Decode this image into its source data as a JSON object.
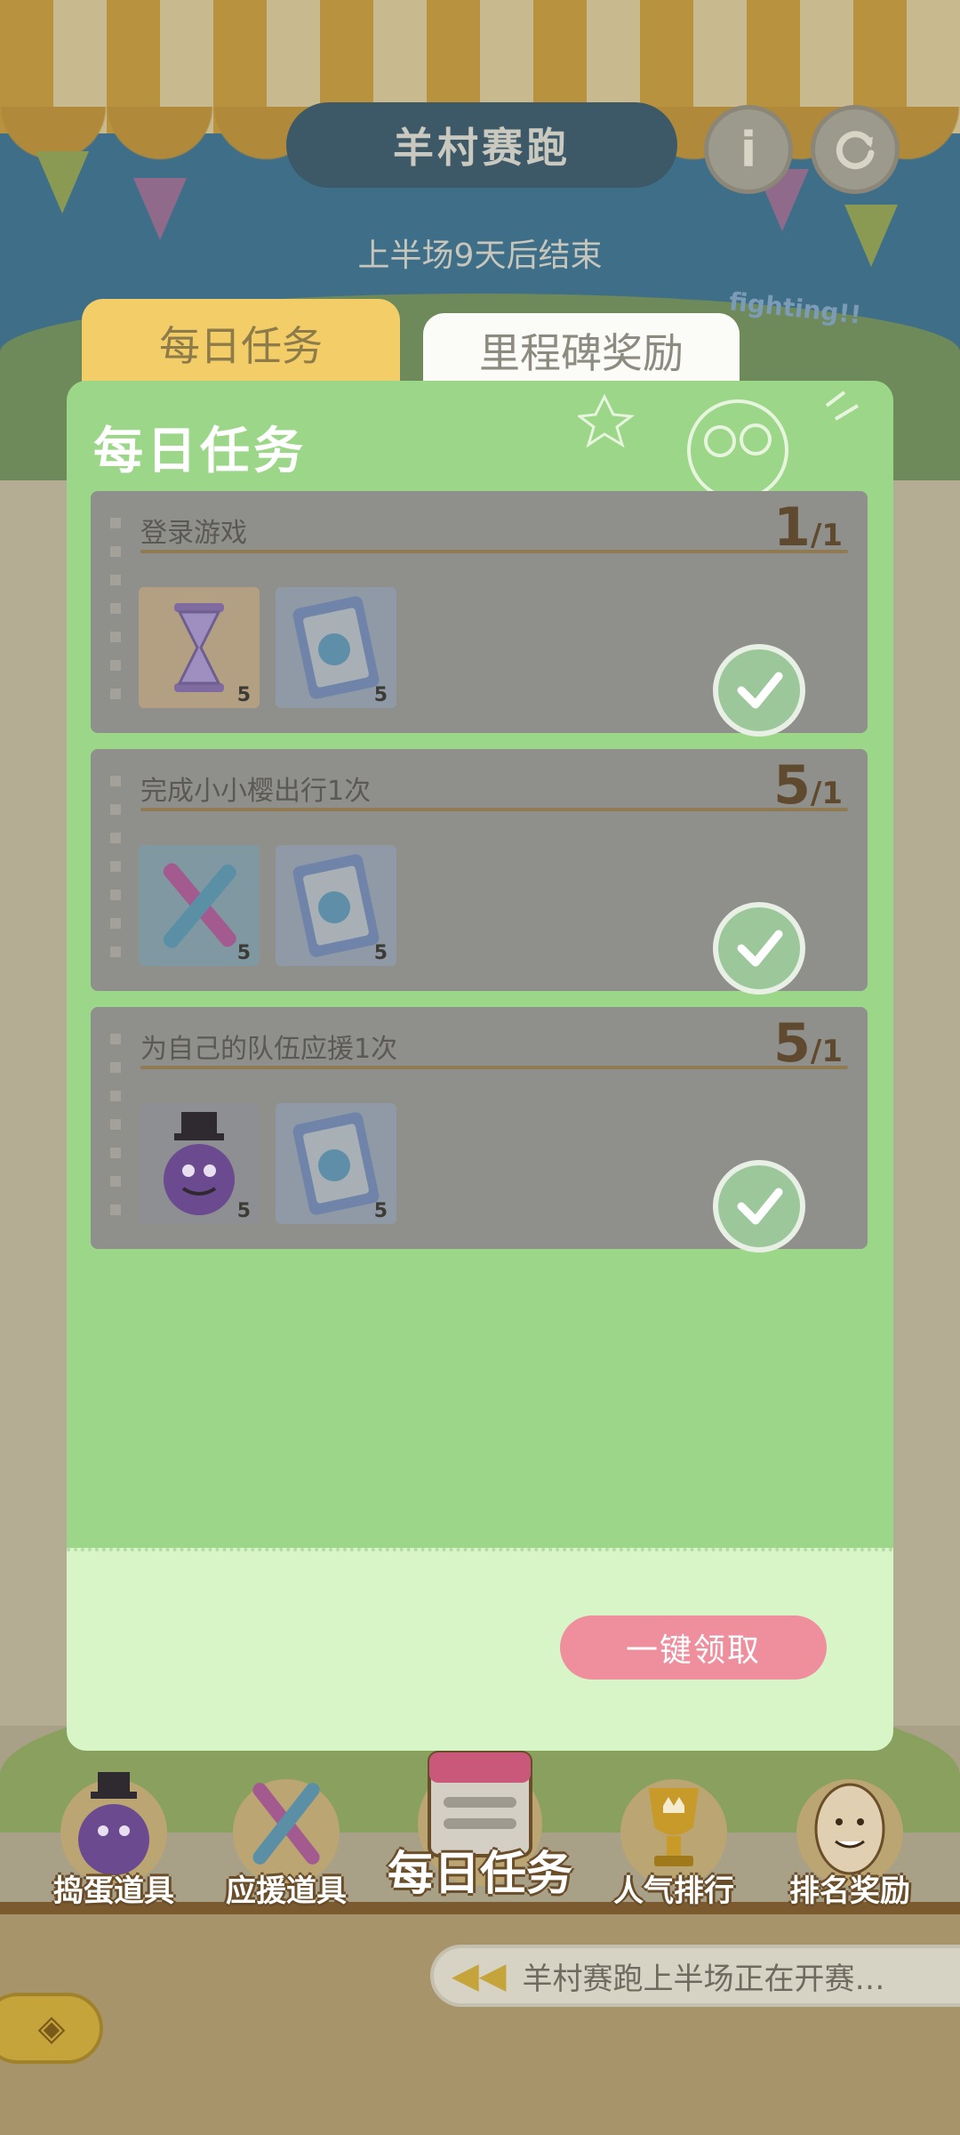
{
  "header": {
    "title": "羊村赛跑",
    "subtitle": "上半场9天后结束",
    "info_icon": "info-icon",
    "refresh_icon": "refresh-icon",
    "bubble_text": "fighting!!"
  },
  "tabs": [
    {
      "label": "每日任务",
      "active": true
    },
    {
      "label": "里程碑奖励",
      "active": false
    }
  ],
  "panel": {
    "title": "每日任务",
    "tasks": [
      {
        "name": "登录游戏",
        "progress": "1",
        "total": "/1",
        "rewards": [
          {
            "icon": "hourglass-icon",
            "count": "5"
          },
          {
            "icon": "ticket-card-icon",
            "count": "5"
          }
        ],
        "completed": true
      },
      {
        "name": "完成小小樱出行1次",
        "progress": "5",
        "total": "/1",
        "rewards": [
          {
            "icon": "glow-sticks-icon",
            "count": "5"
          },
          {
            "icon": "ticket-card-icon",
            "count": "5"
          }
        ],
        "completed": true
      },
      {
        "name": "为自己的队伍应援1次",
        "progress": "5",
        "total": "/1",
        "rewards": [
          {
            "icon": "purple-monster-icon",
            "count": "5"
          },
          {
            "icon": "ticket-card-icon",
            "count": "5"
          }
        ],
        "completed": true
      }
    ],
    "claim_all_label": "一键领取"
  },
  "bottom_nav": [
    {
      "label": "捣蛋道具",
      "icon": "purple-monster-icon"
    },
    {
      "label": "应援道具",
      "icon": "glow-sticks-icon"
    },
    {
      "label": "每日任务",
      "icon": "calendar-icon"
    },
    {
      "label": "人气排行",
      "icon": "trophy-icon"
    },
    {
      "label": "排名奖励",
      "icon": "egg-face-icon"
    }
  ],
  "ticker": {
    "text": "羊村赛跑上半场正在开赛…"
  },
  "colors": {
    "accent_pink": "#ef8f9e",
    "panel_green": "#9cd688",
    "tab_yellow": "#f3cd68"
  }
}
